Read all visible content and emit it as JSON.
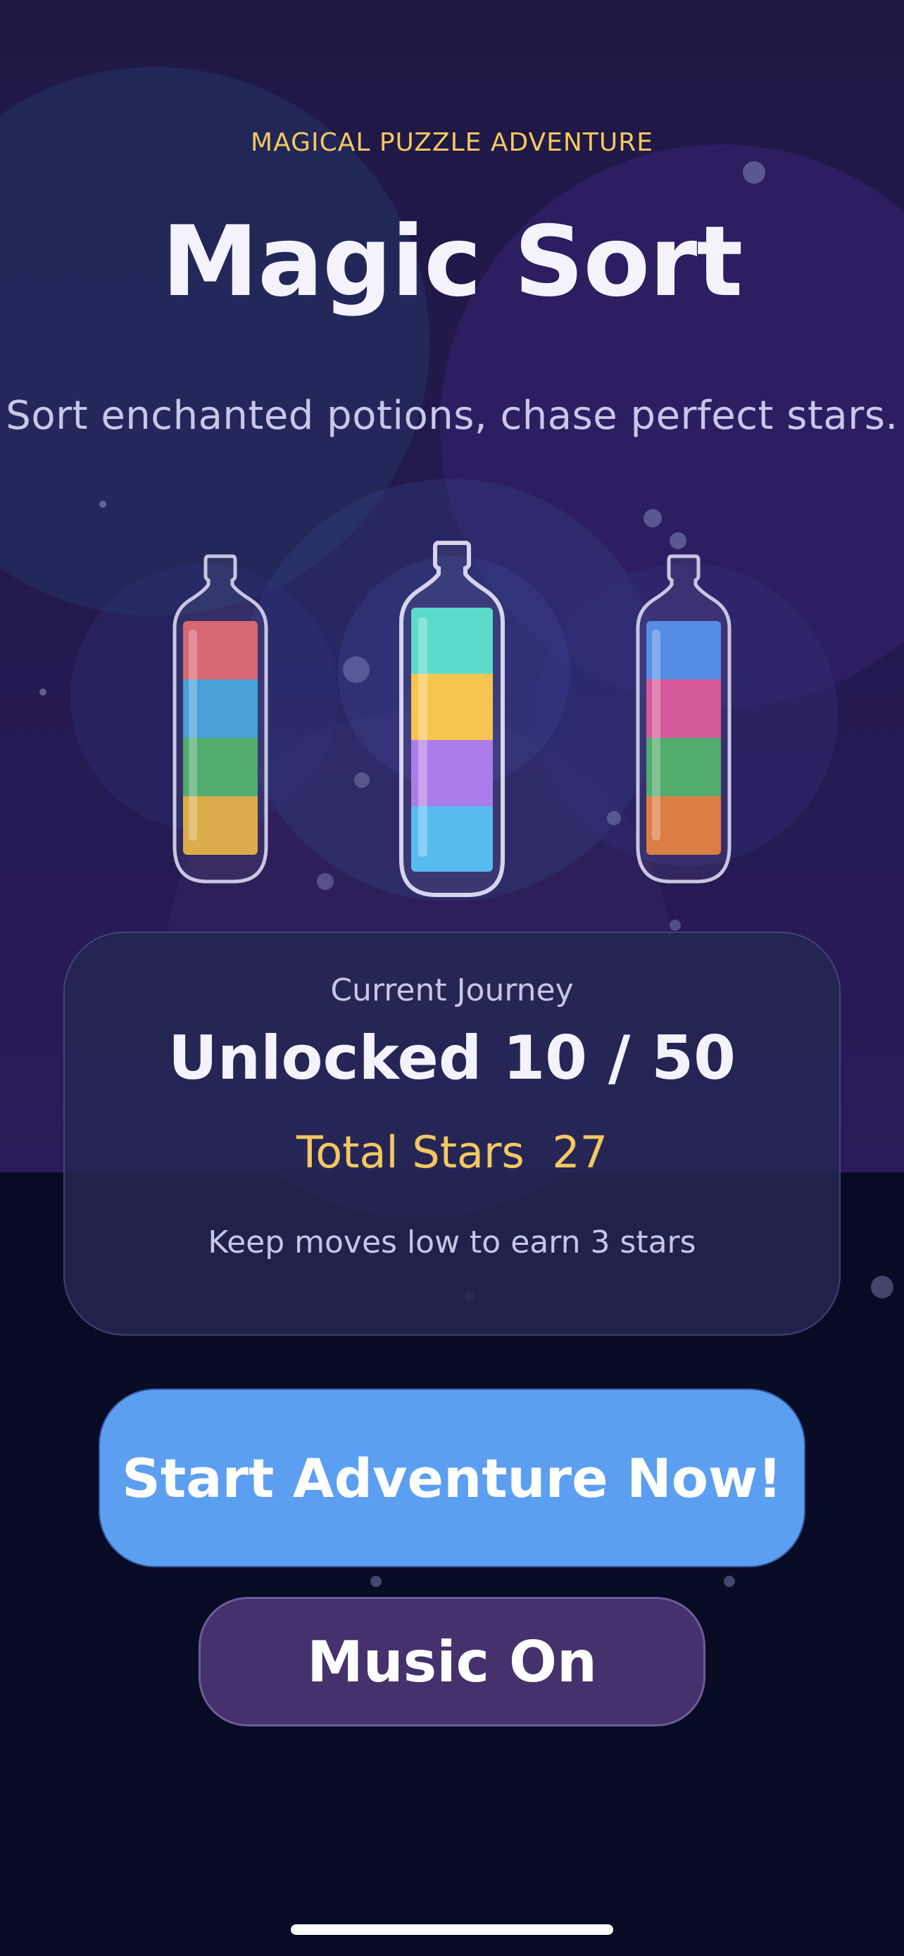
{
  "header": {
    "tagline": "MAGICAL PUZZLE ADVENTURE",
    "title": "Magic Sort",
    "subtitle": "Sort enchanted potions, chase perfect stars."
  },
  "showcase": {
    "bottles": [
      {
        "name": "left-potion-bottle",
        "layers": [
          "#d65f6b",
          "#3e9bd4",
          "#46a867",
          "#d9a83f"
        ]
      },
      {
        "name": "center-potion-bottle",
        "layers": [
          "#52d9c7",
          "#f5c244",
          "#a675ea",
          "#4eb7f0"
        ]
      },
      {
        "name": "right-potion-bottle",
        "layers": [
          "#4c86e3",
          "#d34f95",
          "#47a765",
          "#d9763a"
        ]
      }
    ]
  },
  "journey": {
    "label": "Current Journey",
    "progress": "Unlocked 10 / 50",
    "levels_unlocked": 10,
    "levels_total": 50,
    "stars_text": "Total Stars  27",
    "tip": "Keep moves low to earn 3 stars"
  },
  "actions": {
    "start_label": "Start Adventure Now!",
    "music_label": "Music On"
  },
  "colors": {
    "accent_gold": "#f4c861",
    "primary_button": "#5c9ff0",
    "secondary_button": "#45316c",
    "background_top": "#1f1844",
    "background_bottom": "#070b24"
  }
}
